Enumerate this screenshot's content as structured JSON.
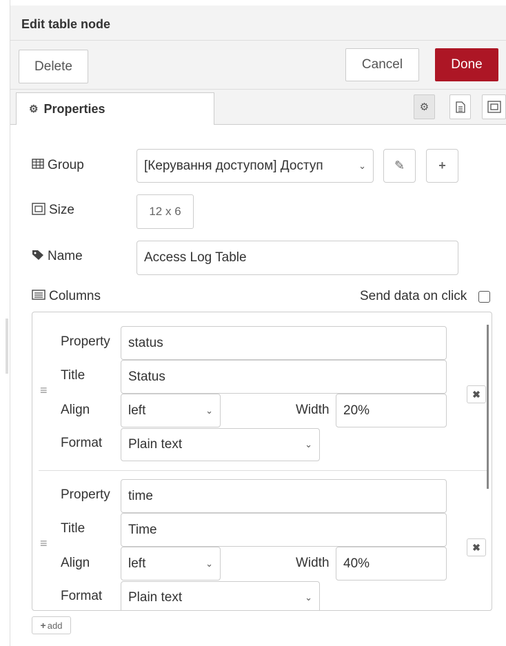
{
  "header": {
    "title": "Edit table node"
  },
  "toolbar": {
    "delete_label": "Delete",
    "cancel_label": "Cancel",
    "done_label": "Done"
  },
  "tabs": [
    {
      "label": "Properties",
      "icon": "gear-icon"
    }
  ],
  "tab_icons": [
    "gear-icon",
    "document-icon",
    "layout-frame-icon"
  ],
  "form": {
    "group": {
      "label": "Group",
      "icon": "table-grid-icon",
      "value": "[Керування доступом] Доступ"
    },
    "size": {
      "label": "Size",
      "icon": "size-frame-icon",
      "value": "12 x 6"
    },
    "name": {
      "label": "Name",
      "icon": "tag-icon",
      "value": "Access Log Table"
    },
    "columns": {
      "label": "Columns",
      "icon": "list-icon"
    },
    "send_data_label": "Send data on click",
    "send_data_checked": false
  },
  "column_labels": {
    "property": "Property",
    "title": "Title",
    "align": "Align",
    "width": "Width",
    "format": "Format"
  },
  "columns": [
    {
      "property": "status",
      "title": "Status",
      "align": "left",
      "width": "20%",
      "format": "Plain text"
    },
    {
      "property": "time",
      "title": "Time",
      "align": "left",
      "width": "40%",
      "format": "Plain text"
    }
  ],
  "add_label": "add",
  "colors": {
    "done": "#ad1625",
    "header_bg": "#f3f3f3"
  }
}
